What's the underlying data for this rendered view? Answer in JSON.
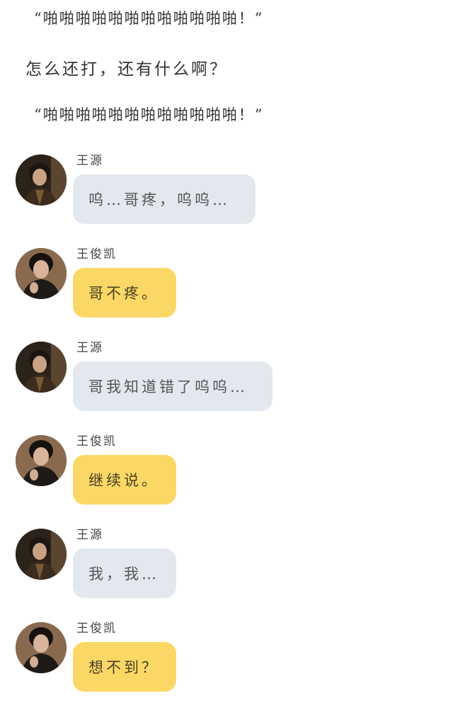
{
  "narration": [
    "“啪啪啪啪啪啪啪啪啪啪啪啪！”",
    "怎么还打，还有什么啊？",
    "“啪啪啪啪啪啪啪啪啪啪啪啪！”"
  ],
  "messages": [
    {
      "sender": "王源",
      "text": "呜…哥疼，呜呜…",
      "bubble_color": "#e3e8ef"
    },
    {
      "sender": "王俊凯",
      "text": "哥不疼。",
      "bubble_color": "#fbd866"
    },
    {
      "sender": "王源",
      "text": "哥我知道错了呜呜…",
      "bubble_color": "#e3e8ef"
    },
    {
      "sender": "王俊凯",
      "text": "继续说。",
      "bubble_color": "#fbd866"
    },
    {
      "sender": "王源",
      "text": "我，我…",
      "bubble_color": "#e3e8ef"
    },
    {
      "sender": "王俊凯",
      "text": "想不到？",
      "bubble_color": "#fbd866"
    }
  ],
  "icons": {
    "avatar_wangyuan": "avatar-photo",
    "avatar_wangjunkai": "avatar-photo"
  }
}
